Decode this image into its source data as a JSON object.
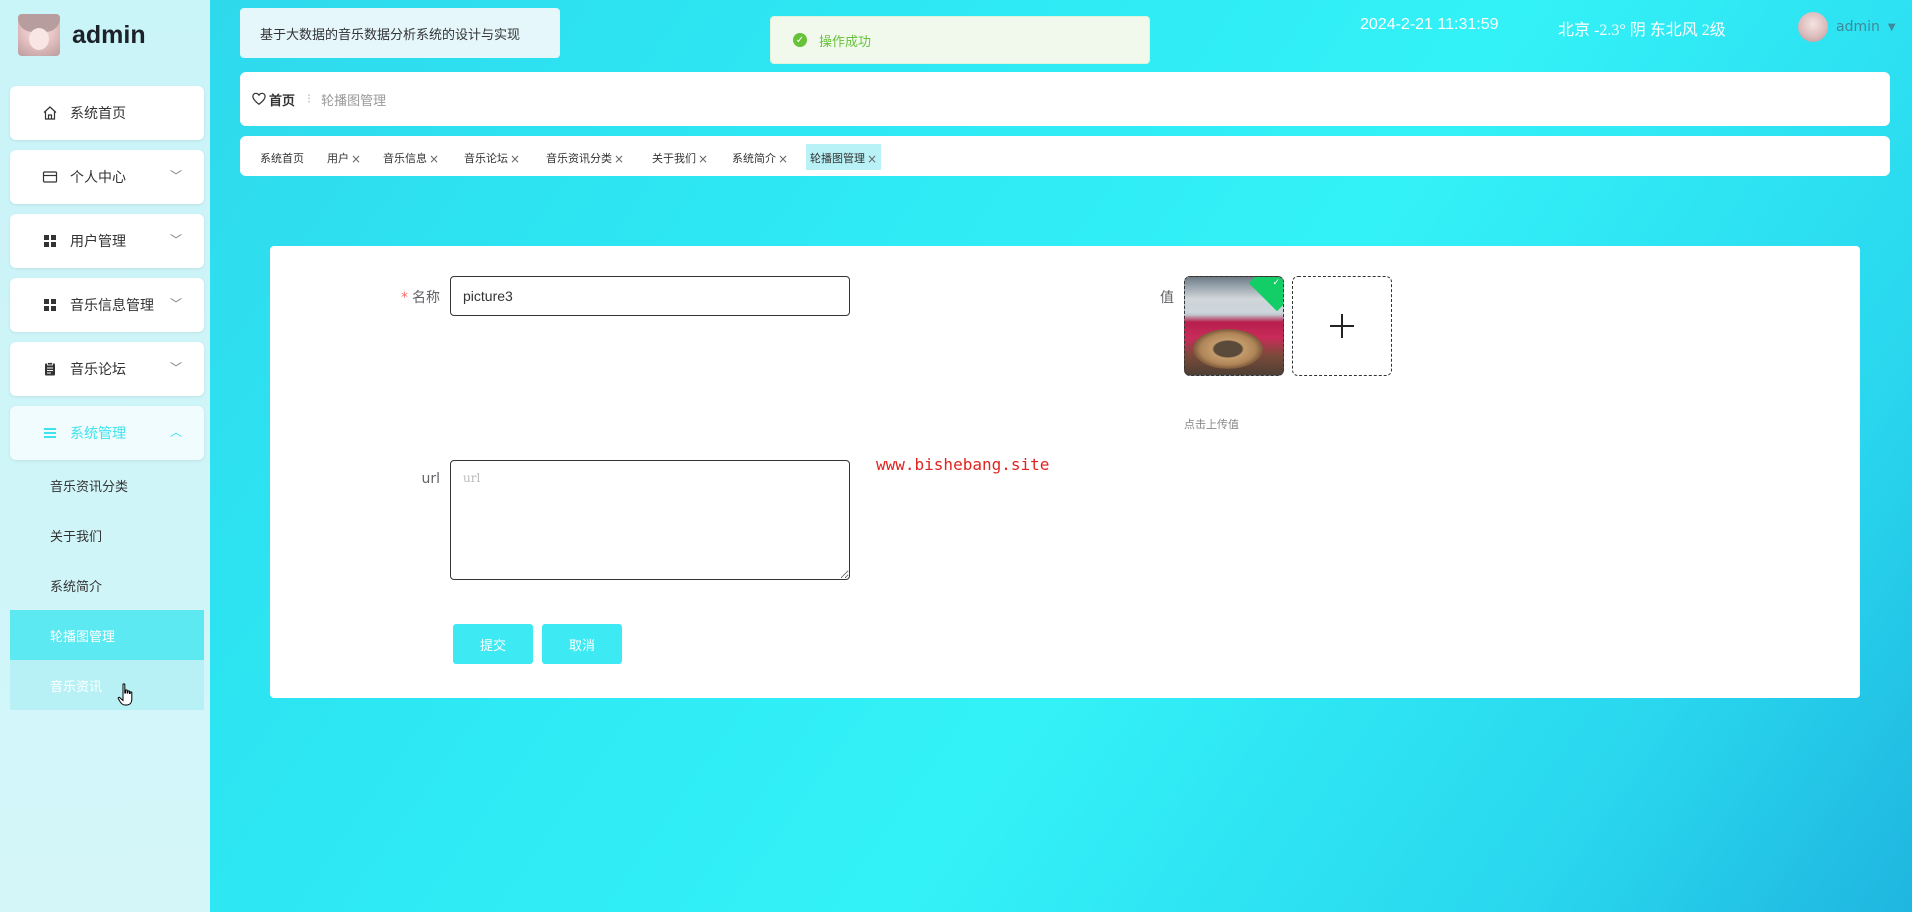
{
  "brand": {
    "title": "admin"
  },
  "sidebar": {
    "items": [
      {
        "label": "系统首页",
        "icon": "home-icon"
      },
      {
        "label": "个人中心",
        "icon": "card-icon",
        "chevron": "﹀"
      },
      {
        "label": "用户管理",
        "icon": "grid-icon",
        "chevron": "﹀"
      },
      {
        "label": "音乐信息管理",
        "icon": "grid-icon",
        "chevron": "﹀"
      },
      {
        "label": "音乐论坛",
        "icon": "clipboard-icon",
        "chevron": "﹀"
      },
      {
        "label": "系统管理",
        "icon": "list-icon",
        "chevron": "︿"
      }
    ],
    "sub_items": [
      {
        "label": "音乐资讯分类"
      },
      {
        "label": "关于我们"
      },
      {
        "label": "系统简介"
      },
      {
        "label": "轮播图管理"
      },
      {
        "label": "音乐资讯"
      }
    ]
  },
  "header": {
    "system_title": "基于大数据的音乐数据分析系统的设计与实现",
    "toast": "操作成功",
    "datetime": "2024-2-21 11:31:59",
    "weather": "北京  -2.3°  阴  东北风  2级",
    "user_name": "admin",
    "user_caret": "▼"
  },
  "breadcrumb": {
    "home": "首页",
    "separator": "⁝",
    "current": "轮播图管理"
  },
  "tags": [
    {
      "label": "系统首页",
      "closable": false
    },
    {
      "label": "用户",
      "closable": true
    },
    {
      "label": "音乐信息",
      "closable": true
    },
    {
      "label": "音乐论坛",
      "closable": true
    },
    {
      "label": "音乐资讯分类",
      "closable": true
    },
    {
      "label": "关于我们",
      "closable": true
    },
    {
      "label": "系统简介",
      "closable": true
    },
    {
      "label": "轮播图管理",
      "closable": true
    }
  ],
  "form": {
    "name_label": "名称",
    "required_mark": "*",
    "name_value": "picture3",
    "value_label": "值",
    "upload_hint": "点击上传值",
    "url_label": "url",
    "url_placeholder": "url",
    "watermark": "www.bishebang.site",
    "submit_label": "提交",
    "cancel_label": "取消"
  },
  "colors": {
    "accent": "#3de9f2",
    "success": "#67c23a",
    "required": "#f56c6c",
    "watermark": "#e0241f"
  }
}
